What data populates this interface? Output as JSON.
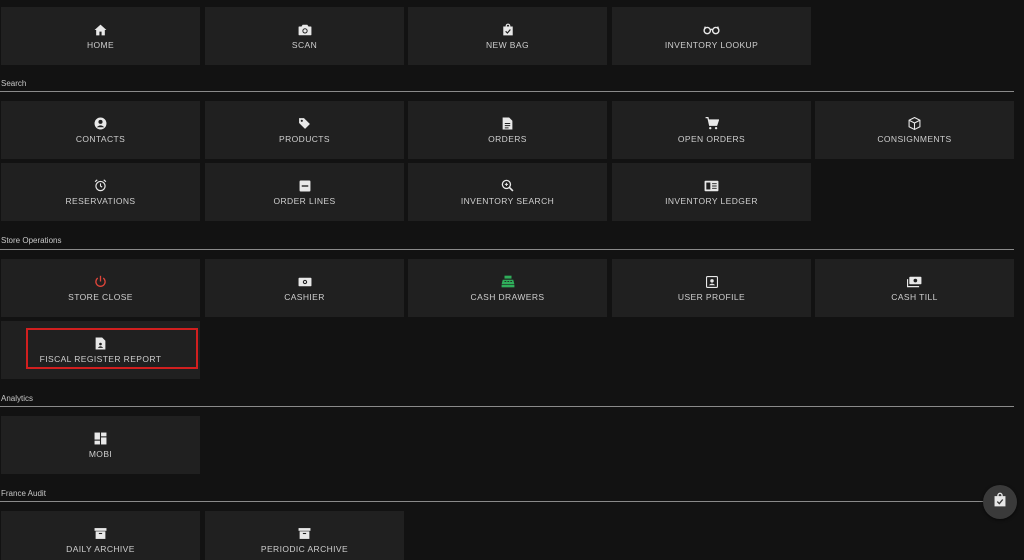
{
  "colors": {
    "background": "#121212",
    "tile": "#202020",
    "icon": "#e8e8e8",
    "store_close_icon": "#e0453a",
    "cash_drawers_icon": "#2fae5a",
    "highlight": "#d11f1f"
  },
  "top": {
    "home": "HOME",
    "scan": "SCAN",
    "new_bag": "NEW BAG",
    "inventory_lookup": "INVENTORY LOOKUP"
  },
  "search": {
    "title": "Search",
    "contacts": "CONTACTS",
    "products": "PRODUCTS",
    "orders": "ORDERS",
    "open_orders": "OPEN ORDERS",
    "consignments": "CONSIGNMENTS",
    "reservations": "RESERVATIONS",
    "order_lines": "ORDER LINES",
    "inventory_search": "INVENTORY SEARCH",
    "inventory_ledger": "INVENTORY LEDGER"
  },
  "store_operations": {
    "title": "Store Operations",
    "store_close": "STORE CLOSE",
    "cashier": "CASHIER",
    "cash_drawers": "CASH DRAWERS",
    "user_profile": "USER PROFILE",
    "cash_till": "CASH TILL",
    "fiscal_register_report": "FISCAL REGISTER REPORT"
  },
  "analytics": {
    "title": "Analytics",
    "mobi": "MOBI"
  },
  "france_audit": {
    "title": "France Audit",
    "daily_archive": "DAILY ARCHIVE",
    "periodic_archive": "PERIODIC ARCHIVE"
  },
  "icons": {
    "home": "home-icon",
    "scan": "camera-icon",
    "new_bag": "shopping-bag-icon",
    "inventory_lookup": "glasses-icon",
    "contacts": "account-circle-icon",
    "products": "tag-icon",
    "orders": "document-icon",
    "open_orders": "cart-icon",
    "consignments": "box-icon",
    "reservations": "alarm-clock-icon",
    "order_lines": "list-box-icon",
    "inventory_search": "search-zoom-icon",
    "inventory_ledger": "ledger-icon",
    "store_close": "power-icon",
    "cashier": "cash-icon",
    "cash_drawers": "cash-register-icon",
    "user_profile": "user-box-icon",
    "cash_till": "cash-multiple-icon",
    "fiscal_register_report": "file-user-icon",
    "mobi": "dashboard-icon",
    "daily_archive": "archive-icon",
    "periodic_archive": "archive-icon",
    "fab": "shopping-bag-check-icon"
  }
}
